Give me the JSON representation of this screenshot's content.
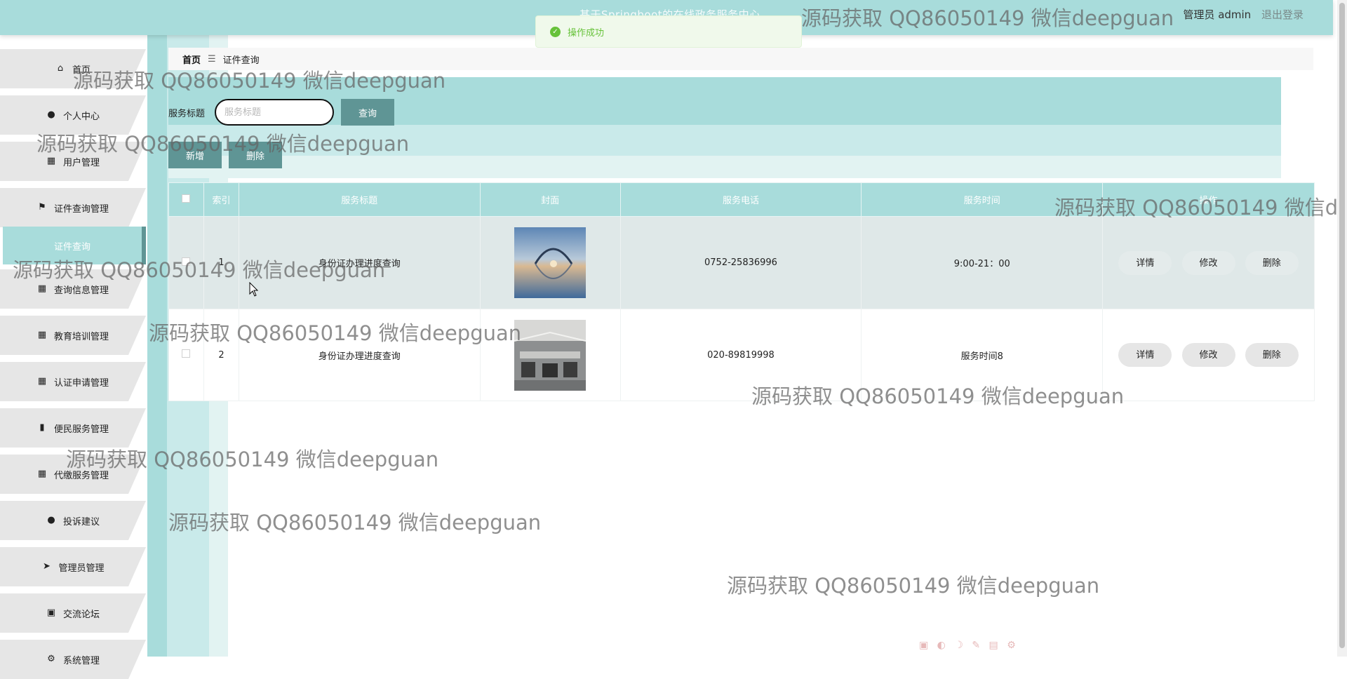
{
  "header": {
    "system_title": "基于Springboot的在线政务服务中心",
    "role": "管理员 admin",
    "logout": "退出登录"
  },
  "toast": {
    "message": "操作成功"
  },
  "sidebar": {
    "items": [
      {
        "label": "首页",
        "icon": "home-icon"
      },
      {
        "label": "个人中心",
        "icon": "user-icon"
      },
      {
        "label": "用户管理",
        "icon": "grid-icon"
      },
      {
        "label": "证件查询管理",
        "icon": "flag-icon"
      },
      {
        "label": "证件查询",
        "sub": true
      },
      {
        "label": "查询信息管理",
        "icon": "grid-icon"
      },
      {
        "label": "教育培训管理",
        "icon": "grid-icon"
      },
      {
        "label": "认证申请管理",
        "icon": "grid-icon"
      },
      {
        "label": "便民服务管理",
        "icon": "bar-chart-icon"
      },
      {
        "label": "代缴服务管理",
        "icon": "grid-icon"
      },
      {
        "label": "投诉建议",
        "icon": "user-icon"
      },
      {
        "label": "管理员管理",
        "icon": "send-icon"
      },
      {
        "label": "交流论坛",
        "icon": "clipboard-icon"
      },
      {
        "label": "系统管理",
        "icon": "gear-icon"
      }
    ]
  },
  "breadcrumb": {
    "home": "首页",
    "sep": "☰",
    "current": "证件查询"
  },
  "search": {
    "label": "服务标题",
    "placeholder": "服务标题",
    "button": "查询"
  },
  "actions": {
    "add": "新增",
    "delete": "删除"
  },
  "table": {
    "headers": [
      "索引",
      "服务标题",
      "封面",
      "服务电话",
      "服务时间",
      "操作"
    ],
    "rows": [
      {
        "index": "1",
        "title": "身份证办理进度查询",
        "phone": "0752-25836996",
        "time": "9:00-21：00"
      },
      {
        "index": "2",
        "title": "身份证办理进度查询",
        "phone": "020-89819998",
        "time": "服务时间8"
      }
    ],
    "row_actions": {
      "detail": "详情",
      "edit": "修改",
      "delete": "删除"
    }
  },
  "watermark": "源码获取 QQ86050149 微信deepguan",
  "colors": {
    "accent": "#a8dcdb",
    "button": "#5f9595",
    "success": "#67c23a"
  }
}
